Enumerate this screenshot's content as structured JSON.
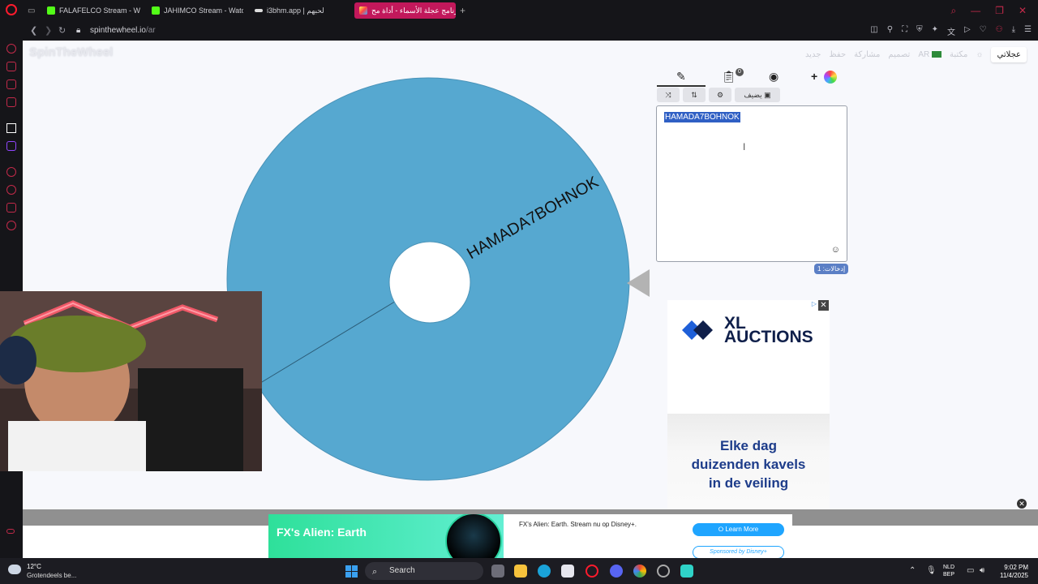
{
  "browser": {
    "tabs": [
      {
        "label": "FALAFELCO Stream - Wat",
        "fav_color": "#53fc18"
      },
      {
        "label": "JAHIMCO Stream - Watc",
        "fav_color": "#53fc18"
      },
      {
        "label": "i3bhm.app | لحبهم",
        "fav_color": "#dddddd"
      },
      {
        "label": "برنامج عجلة الأسماء - أداة مح",
        "fav_color": "#ffcc33",
        "active": true
      }
    ],
    "new_tab": "+",
    "url_host": "spinthewheel.io",
    "url_path": "/ar"
  },
  "site": {
    "logo": "SpinTheWheel",
    "nav": [
      "عجلاتي",
      "مكتبة",
      "AR",
      "تصميم",
      "مشاركة",
      "حفظ",
      "جديد"
    ],
    "language_flag": "AR"
  },
  "wheel": {
    "segments": [
      {
        "label": "HAMADA7BOHNOK",
        "color": "#56a8d0"
      }
    ],
    "pointer_color": "#b3b3b3"
  },
  "editor": {
    "tabs": [
      "edit-icon",
      "clipboard-icon",
      "hide-icon",
      "add-color-icon"
    ],
    "tab_badge": "0",
    "add_plus": "+",
    "controls": {
      "shuffle": "⤨",
      "sort": "⇅",
      "settings": "⚙",
      "add_image_label": "يضيف"
    },
    "entries_text": "HAMADA7BOHNOK",
    "entries_count_label": "إدخالات: 1"
  },
  "ad_xl": {
    "brand": "XL AUCTIONS",
    "tagline_lines": [
      "Elke dag",
      "duizenden kavels",
      "in de veiling"
    ],
    "close": "✕",
    "adchoice": "▷"
  },
  "ad_fx": {
    "title": "FX's Alien: Earth",
    "description": "FX's Alien: Earth. Stream nu op Disney+.",
    "cta": "⭘ Learn More",
    "sponsor": "Sponsored by Disney+"
  },
  "taskbar": {
    "weather_temp": "12°C",
    "weather_desc": "Grotendeels be...",
    "search": "Search",
    "lang_line1": "NLD",
    "lang_line2": "BEP",
    "time": "9:02 PM",
    "date": "11/4/2025"
  },
  "colors": {
    "wheel_blue": "#56a8d0",
    "selection": "#2f5fc4",
    "opera_red": "#ff1b2d",
    "ad_navy": "#0f1f4a",
    "fx_green": "#2ee09a"
  }
}
